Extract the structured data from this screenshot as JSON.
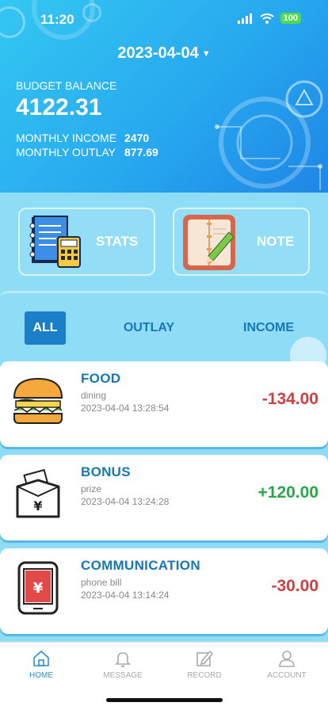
{
  "status_bar": {
    "time": "11:20",
    "battery": "100"
  },
  "header": {
    "date": "2023-04-04",
    "budget_balance_label": "BUDGET BALANCE",
    "budget_balance_value": "4122.31",
    "monthly_income_label": "MONTHLY INCOME",
    "monthly_income_value": "2470",
    "monthly_outlay_label": "MONTHLY OUTLAY",
    "monthly_outlay_value": "877.69"
  },
  "cards": {
    "stats_label": "STATS",
    "note_label": "NOTE"
  },
  "filter_tabs": {
    "all": "ALL",
    "outlay": "OUTLAY",
    "income": "INCOME"
  },
  "transactions": [
    {
      "title": "FOOD",
      "subtitle": "dining",
      "time": "2023-04-04 13:28:54",
      "amount": "-134.00",
      "icon": "burger-icon"
    },
    {
      "title": "BONUS",
      "subtitle": "prize",
      "time": "2023-04-04 13:24:28",
      "amount": "+120.00",
      "icon": "money-envelope-icon"
    },
    {
      "title": "COMMUNICATION",
      "subtitle": "phone bill",
      "time": "2023-04-04 13:14:24",
      "amount": "-30.00",
      "icon": "phone-bill-icon"
    }
  ],
  "bottom_nav": {
    "home": "HOME",
    "message": "MESSAGE",
    "record": "RECORD",
    "account": "ACCOUNT"
  },
  "colors": {
    "accent": "#1a7fc8",
    "negative": "#d04040",
    "positive": "#27a84a",
    "panel_bg": "#8fdcf7"
  }
}
